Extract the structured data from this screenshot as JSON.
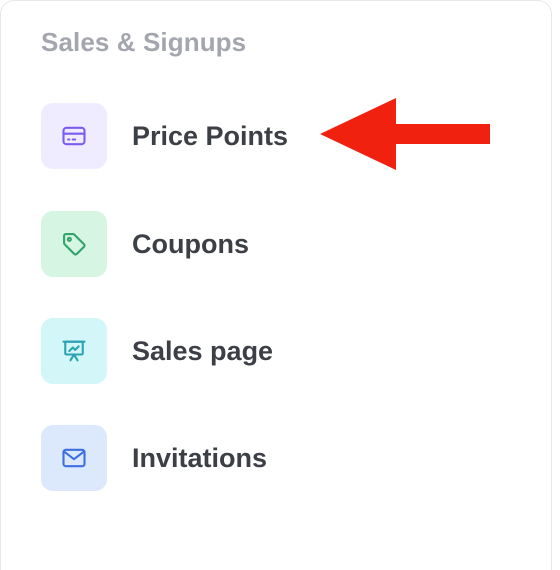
{
  "section": {
    "title": "Sales & Signups"
  },
  "items": [
    {
      "label": "Price Points",
      "icon": "credit-card-icon",
      "bg": "#efecff",
      "color": "#7a5cf0"
    },
    {
      "label": "Coupons",
      "icon": "tag-icon",
      "bg": "#d6f5e3",
      "color": "#2fa56c"
    },
    {
      "label": "Sales page",
      "icon": "presentation-icon",
      "bg": "#d3f6f8",
      "color": "#2aa3b2"
    },
    {
      "label": "Invitations",
      "icon": "envelope-icon",
      "bg": "#dce8fc",
      "color": "#3d6fe0"
    }
  ],
  "annotation": {
    "arrow_color": "#f0220f",
    "points_to": "Price Points"
  }
}
